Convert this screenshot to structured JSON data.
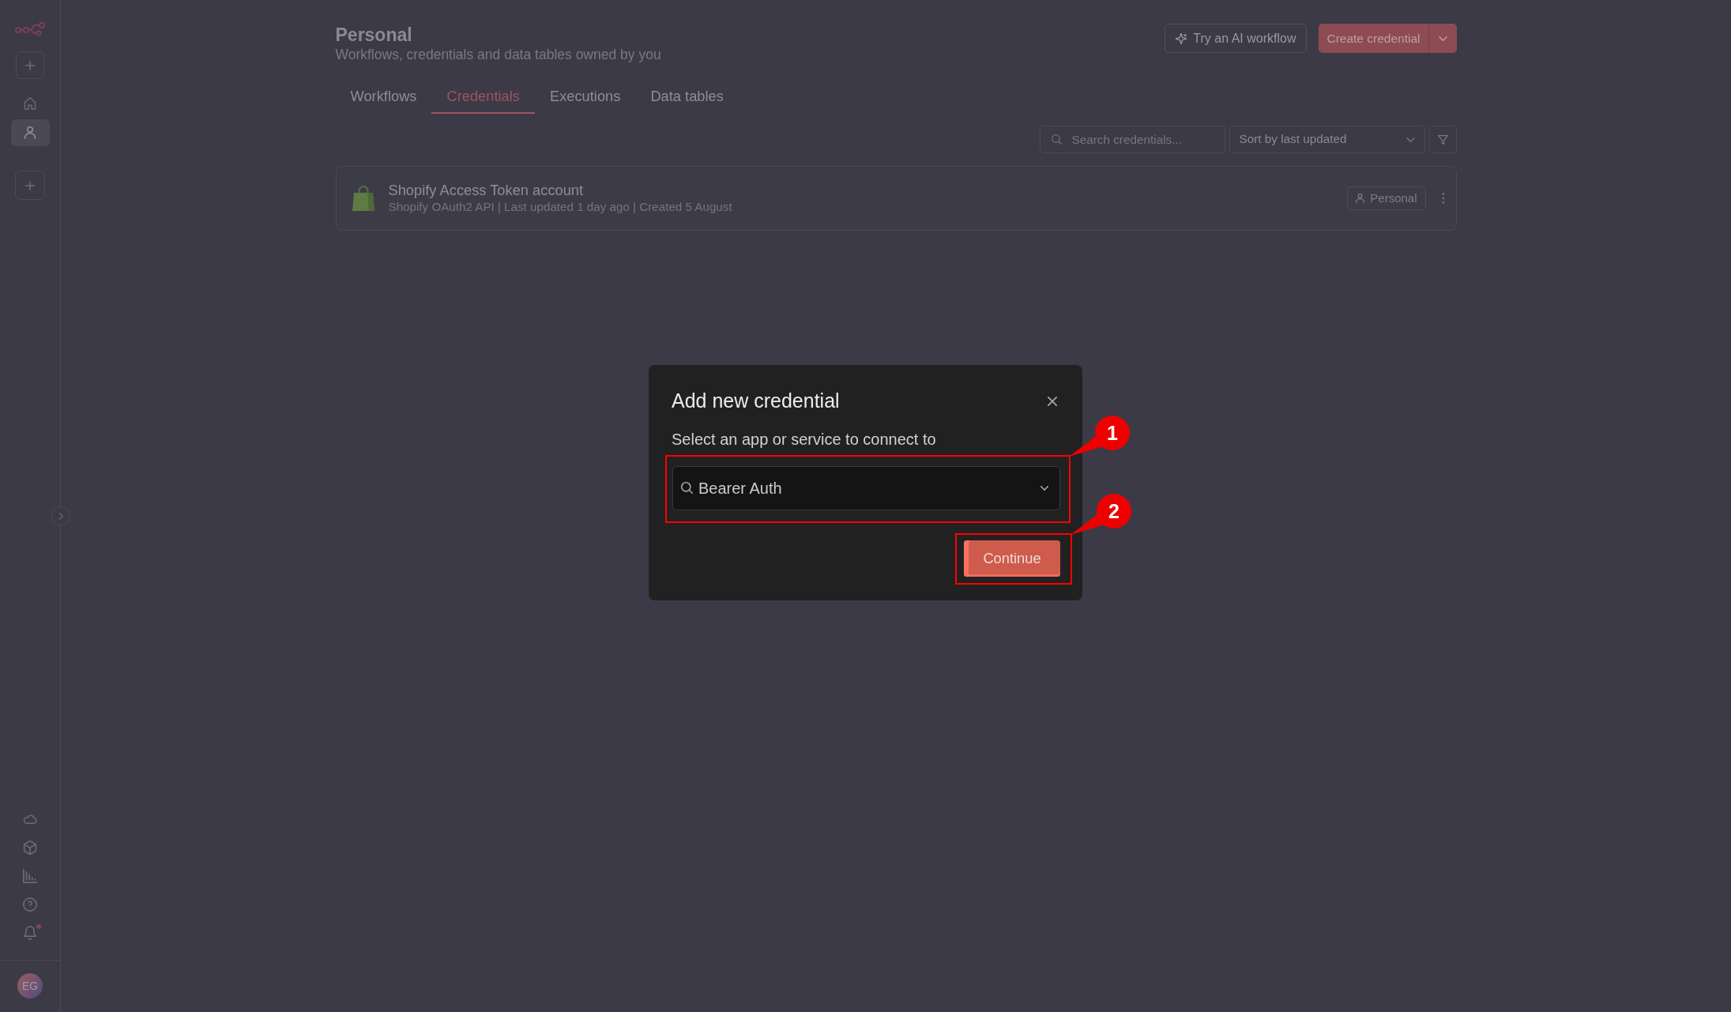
{
  "sidebar": {
    "nav": [
      {
        "kind": "home",
        "selected": false
      },
      {
        "kind": "person",
        "selected": true
      }
    ],
    "footer": [
      {
        "kind": "cloud"
      },
      {
        "kind": "package"
      },
      {
        "kind": "chart"
      },
      {
        "kind": "help"
      },
      {
        "kind": "bell",
        "unread": true
      }
    ],
    "user": {
      "initials": "EG"
    }
  },
  "header": {
    "title": "Personal",
    "subtitle": "Workflows, credentials and data tables owned by you",
    "actions": [
      {
        "kind": "outline",
        "label": "Try an AI workflow"
      },
      {
        "kind": "split",
        "label": "Create credential"
      }
    ]
  },
  "tabs": [
    {
      "label": "Workflows",
      "selected": false
    },
    {
      "label": "Credentials",
      "selected": true
    },
    {
      "label": "Executions",
      "selected": false
    },
    {
      "label": "Data tables",
      "selected": false
    }
  ],
  "toolbar": {
    "search": {
      "placeholder": "Search credentials..."
    },
    "sort": {
      "value": "Sort by last updated"
    }
  },
  "credentials": [
    {
      "name": "Shopify Access Token account",
      "details": "Shopify OAuth2 API | Last updated 1 day ago | Created 5 August",
      "owner": "Personal"
    }
  ],
  "modal": {
    "title": "Add new credential",
    "label": "Select an app or service to connect to",
    "select": {
      "value": "Bearer Auth",
      "callout": "1"
    },
    "button": {
      "label": "Continue",
      "callout": "2"
    }
  }
}
